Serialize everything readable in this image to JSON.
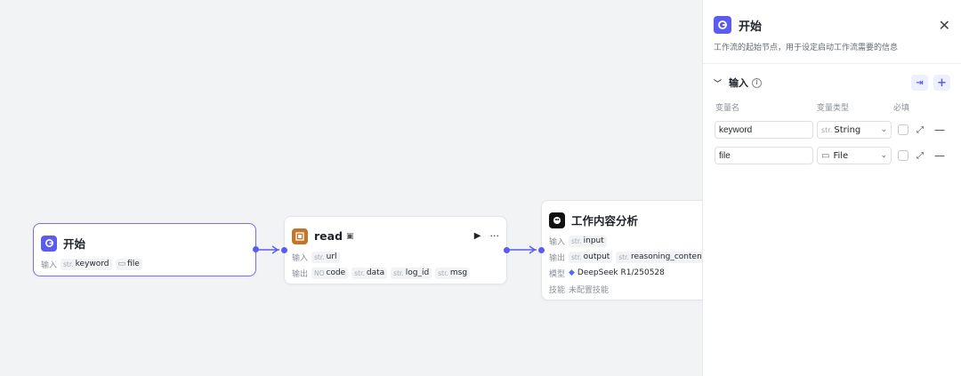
{
  "nodes": {
    "start": {
      "title": "开始",
      "input_label": "输入",
      "vars": [
        {
          "type": "str",
          "name": "keyword"
        },
        {
          "type": "folder",
          "name": "file"
        }
      ]
    },
    "read": {
      "title": "read",
      "input_label": "输入",
      "output_label": "输出",
      "inputs": [
        {
          "type": "str",
          "name": "url"
        }
      ],
      "outputs": [
        {
          "type": "NO",
          "name": "code"
        },
        {
          "type": "str",
          "name": "data"
        },
        {
          "type": "str",
          "name": "log_id"
        },
        {
          "type": "str",
          "name": "msg"
        }
      ]
    },
    "analysis": {
      "title": "工作内容分析",
      "input_label": "输入",
      "output_label": "输出",
      "model_label": "模型",
      "skill_label": "技能",
      "inputs": [
        {
          "type": "str",
          "name": "input"
        }
      ],
      "outputs": [
        {
          "type": "str",
          "name": "output"
        },
        {
          "type": "str",
          "name": "reasoning_content"
        }
      ],
      "model": "DeepSeek R1/250528",
      "skill": "未配置技能"
    }
  },
  "panel": {
    "title": "开始",
    "description": "工作流的起始节点，用于设定启动工作流需要的信息",
    "section_title": "输入",
    "col_name": "变量名",
    "col_type": "变量类型",
    "col_required": "必填",
    "variables": [
      {
        "name": "keyword",
        "type_prefix": "str.",
        "type": "String"
      },
      {
        "name": "file",
        "type_prefix": "folder",
        "type": "File"
      }
    ]
  },
  "colors": {
    "accent": "#5b5bf0",
    "selected_border": "#7b6cf6"
  }
}
